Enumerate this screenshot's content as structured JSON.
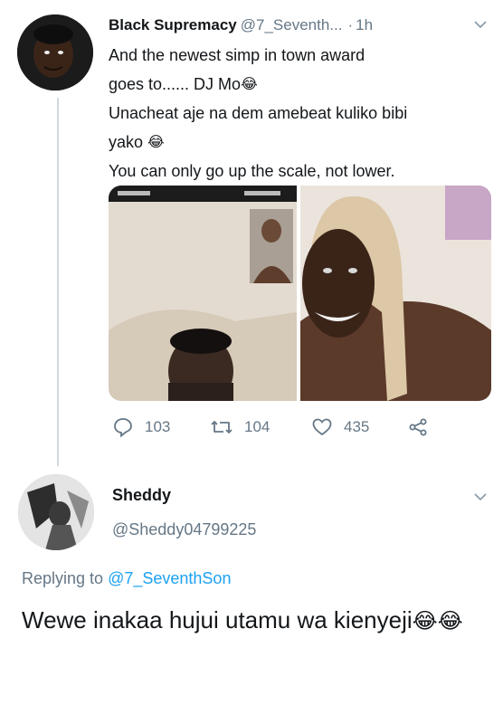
{
  "tweet": {
    "author_name": "Black Supremacy",
    "author_handle": "@7_Seventh...",
    "separator": "·",
    "time": "1h",
    "lines": [
      "And the newest simp in town award",
      "goes to...... DJ Mo",
      "Unacheat aje na dem amebeat kuliko bibi",
      "yako",
      "You can only go up the scale, not lower."
    ],
    "emoji": "😂",
    "stats": {
      "replies": "103",
      "retweets": "104",
      "likes": "435"
    }
  },
  "reply": {
    "author_name": "Sheddy",
    "author_handle": "@Sheddy04799225",
    "replying_prefix": "Replying to",
    "replying_to": "@7_SeventhSon",
    "text": "Wewe inakaa hujui utamu wa kienyeji",
    "emoji": "😂😂"
  }
}
